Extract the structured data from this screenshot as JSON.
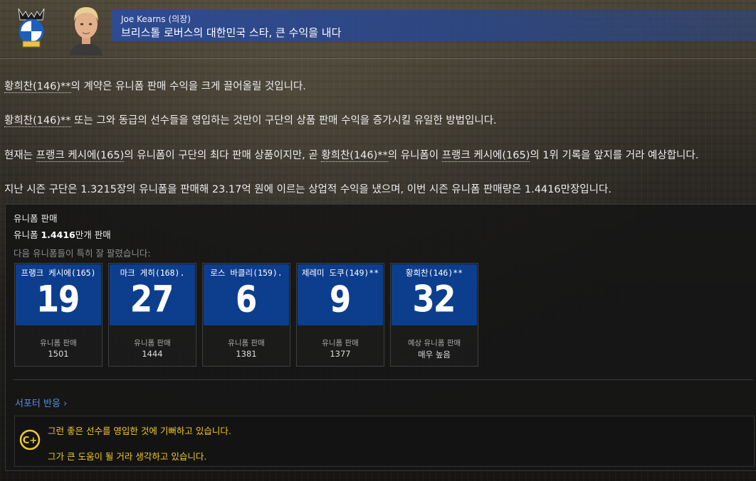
{
  "header": {
    "author": "Joe Kearns  (의장)",
    "headline": "브리스톨 로버스의 대한민국 스타, 큰 수익을 내다",
    "club_logo_icon": "bristol-rovers-crest-icon",
    "portrait_icon": "person-portrait-icon"
  },
  "article": {
    "p1": {
      "player": "황희찬(146)**",
      "rest": "의 계약은 유니폼 판매 수익을 크게 끌어올릴 것입니다."
    },
    "p2": {
      "player": "황희찬(146)**",
      "rest": " 또는 그와 동급의 선수들을 영입하는 것만이 구단의 상품 판매 수익을 증가시킬 유일한 방법입니다."
    },
    "p3": {
      "a": "현재는 ",
      "player1": "프랭크 케시에(165)",
      "b": "의 유니폼이 구단의 최다 판매 상품이지만, 곧 ",
      "player2": "황희찬(146)**",
      "c": "의 유니폼이 ",
      "player3": "프랭크 케시에(165)",
      "d": "의 1위 기록을 앞지를 거라 예상합니다."
    },
    "p4": "지난 시즌 구단은 1.3215장의 유니폼을 판매해 23.17억 원에 이르는 상업적 수익을 냈으며, 이번 시즌 유니폼 판매량은 1.4416만장입니다."
  },
  "panel": {
    "title": "유니폼 판매",
    "sales_prefix": "유니폼 ",
    "sales_value": "1.4416",
    "sales_suffix": "만개 판매",
    "subtitle": "다음 유니폼들이 특히 잘 팔렸습니다:",
    "shirt_color": "#0d3e8e",
    "cards": [
      {
        "name": "프랭크 케시에(165)",
        "number": "19",
        "label": "유니폼 판매",
        "value": "1501"
      },
      {
        "name": "마크 게히(168).",
        "number": "27",
        "label": "유니폼 판매",
        "value": "1444"
      },
      {
        "name": "로스 바클리(159).",
        "number": "6",
        "label": "유니폼 판매",
        "value": "1381"
      },
      {
        "name": "제레미 도쿠(149)**",
        "number": "9",
        "label": "유니폼 판매",
        "value": "1377"
      },
      {
        "name": "황희찬(146)**",
        "number": "32",
        "label": "예상 유니폼 판매",
        "value": "매우 높음"
      }
    ]
  },
  "reactions": {
    "link": "서포터 반응 ›",
    "icon": "c-plus-rating-icon",
    "accent": "#f0c829",
    "line1": "그런 좋은 선수를 영입한 것에 기뻐하고 있습니다.",
    "line2": "그가 큰 도움이 될 거라 생각하고 있습니다."
  }
}
